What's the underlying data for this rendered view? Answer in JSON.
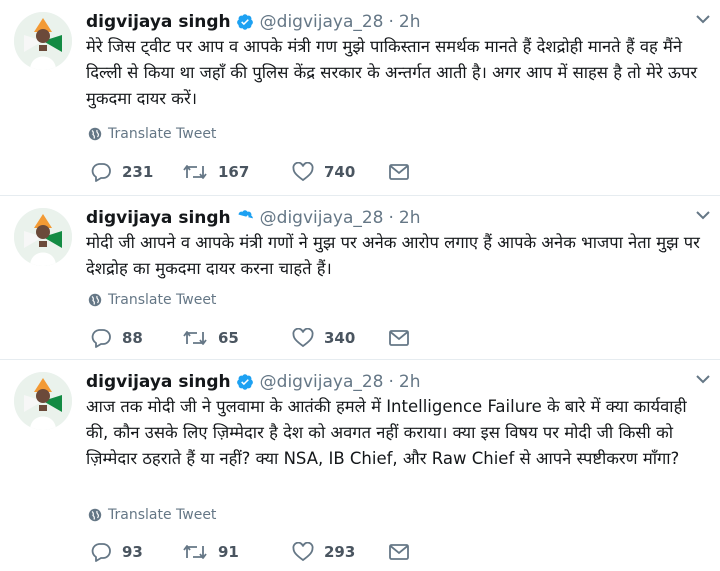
{
  "colors": {
    "verified": "#1da1f2",
    "muted": "#657786",
    "text": "#14171a",
    "divider": "#e6ecf0"
  },
  "tweets": [
    {
      "name": "digvijaya singh",
      "handle": "@digvijaya_28",
      "separator": "·",
      "time": "2h",
      "text": "मेरे जिस ट्वीट पर आप व आपके मंत्री गण मुझे पाकिस्तान समर्थक मानते हैं देशद्रोही मानते हैं वह मैंने दिल्ली से किया था जहाँ की पुलिस केंद्र सरकार के अन्तर्गत आती है। अगर आप में साहस है तो मेरे ऊपर मुकदमा दायर करें।",
      "translate_label": "Translate Tweet",
      "replies": "231",
      "retweets": "167",
      "likes": "740"
    },
    {
      "name": "digvijaya singh",
      "handle": "@digvijaya_28",
      "separator": "·",
      "time": "2h",
      "text": "मोदी जी आपने व आपके मंत्री गणों ने मुझ पर अनेक आरोप लगाए हैं आपके अनेक भाजपा नेता मुझ पर देशद्रोह का मुकदमा दायर करना चाहते हैं।",
      "translate_label": "Translate Tweet",
      "replies": "88",
      "retweets": "65",
      "likes": "340"
    },
    {
      "name": "digvijaya singh",
      "handle": "@digvijaya_28",
      "separator": "·",
      "time": "2h",
      "text": "आज तक मोदी जी ने पुलवामा के आतंकी हमले में Intelligence Failure के बारे में क्या कार्यवाही की, कौन उसके लिए ज़िम्मेदार है देश को अवगत नहीं कराया। क्या इस विषय पर मोदी जी किसी को ज़िम्मेदार ठहराते हैं या नहीं? क्या NSA, IB Chief, और  Raw Chief से आपने स्पष्टीकरण माँगा?",
      "translate_label": "Translate Tweet",
      "replies": "93",
      "retweets": "91",
      "likes": "293"
    }
  ]
}
